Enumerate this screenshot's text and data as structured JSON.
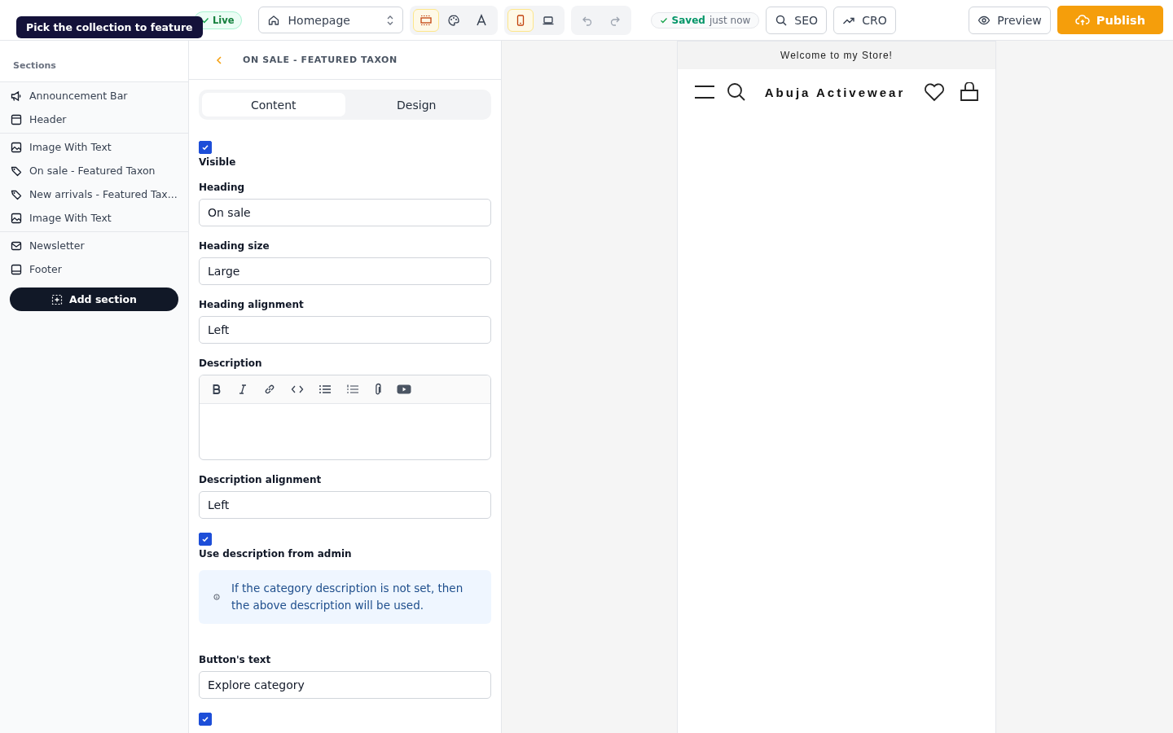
{
  "topbar": {
    "tooltip": "Pick the collection to feature",
    "live_badge": "Live",
    "page_select": {
      "value": "Homepage"
    },
    "tools": [
      {
        "kind": "layout",
        "selected": true
      },
      {
        "kind": "palette",
        "selected": false
      },
      {
        "kind": "type",
        "selected": false
      }
    ],
    "devices": [
      {
        "kind": "mobile",
        "selected": true
      },
      {
        "kind": "desktop",
        "selected": false
      }
    ],
    "history": [
      {
        "kind": "undo",
        "disabled": true
      },
      {
        "kind": "redo",
        "disabled": true
      }
    ],
    "saved": {
      "label": "Saved",
      "time": "just now"
    },
    "buttons": [
      {
        "kind": "seo",
        "label": "SEO"
      },
      {
        "kind": "cro",
        "label": "CRO"
      }
    ],
    "preview": "Preview",
    "publish": "Publish"
  },
  "sidebar": {
    "title": "Sections",
    "groups": [
      [
        {
          "kind": "announcement",
          "label": "Announcement Bar"
        },
        {
          "kind": "header",
          "label": "Header"
        }
      ],
      [
        {
          "kind": "image",
          "label": "Image With Text"
        },
        {
          "kind": "taxon",
          "label": "On sale - Featured Taxon"
        },
        {
          "kind": "taxon",
          "label": "New arrivals - Featured Tax..."
        },
        {
          "kind": "image",
          "label": "Image With Text"
        }
      ],
      [
        {
          "kind": "newsletter",
          "label": "Newsletter"
        },
        {
          "kind": "footer",
          "label": "Footer"
        }
      ]
    ],
    "add_button": "Add section"
  },
  "panel": {
    "title": "ON SALE - FEATURED TAXON",
    "tabs": [
      {
        "label": "Content",
        "selected": true
      },
      {
        "label": "Design",
        "selected": false
      }
    ],
    "fields": [
      {
        "kind": "checkbox",
        "label": "Visible",
        "checked": true
      },
      {
        "kind": "input",
        "label": "Heading",
        "value": "On sale"
      },
      {
        "kind": "input",
        "label": "Heading size",
        "value": "Large"
      },
      {
        "kind": "input",
        "label": "Heading alignment",
        "value": "Left"
      },
      {
        "kind": "richtext",
        "label": "Description"
      },
      {
        "kind": "input",
        "label": "Description alignment",
        "value": "Left"
      },
      {
        "kind": "checkbox",
        "label": "Use description from admin",
        "checked": true
      },
      {
        "kind": "note",
        "text": "If the category description is not set, then the above description will be used."
      },
      {
        "kind": "input",
        "label": "Button's text",
        "value": "Explore category"
      },
      {
        "kind": "checkbox",
        "checked": true
      }
    ]
  },
  "preview": {
    "announcement": "Welcome to my Store!",
    "store_name": "Abuja Activewear"
  }
}
